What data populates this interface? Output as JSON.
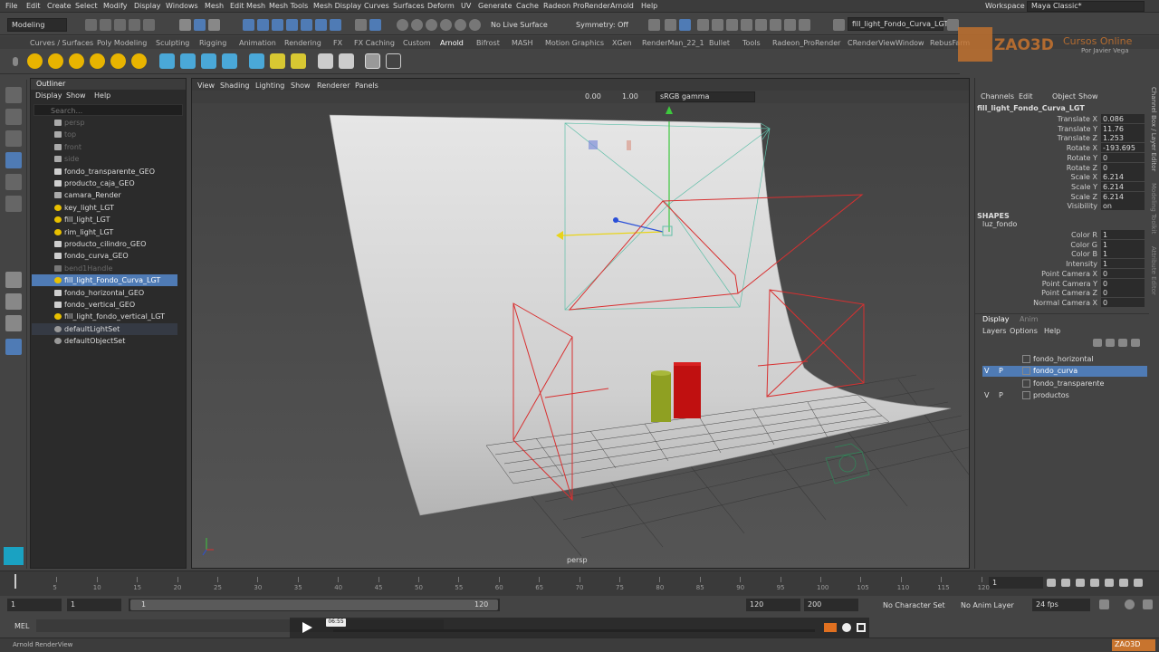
{
  "menubar": {
    "items": [
      "File",
      "Edit",
      "Create",
      "Select",
      "Modify",
      "Display",
      "Windows",
      "Mesh",
      "Edit Mesh",
      "Mesh Tools",
      "Mesh Display",
      "Curves",
      "Surfaces",
      "Deform",
      "UV",
      "Generate",
      "Cache",
      "Radeon ProRender",
      "Arnold",
      "Help"
    ],
    "workspace_label": "Workspace :",
    "workspace_value": "Maya Classic*"
  },
  "status_line": {
    "mode": "Modeling",
    "live_surface": "No Live Surface",
    "symmetry": "Symmetry: Off",
    "active_object": "fill_light_Fondo_Curva_LGT"
  },
  "shelf_tabs": [
    "Curves / Surfaces",
    "Poly Modeling",
    "Sculpting",
    "Rigging",
    "Animation",
    "Rendering",
    "FX",
    "FX Caching",
    "Custom",
    "Arnold",
    "Bifrost",
    "MASH",
    "Motion Graphics",
    "XGen",
    "RenderMan_22_1",
    "Bullet",
    "Tools",
    "Radeon_ProRender",
    "CRenderViewWindow",
    "RebusFarm"
  ],
  "shelf_active": "Arnold",
  "watermark": {
    "brand": "ZAO3D",
    "title": "Cursos Online",
    "subtitle": "Por Javier Vega"
  },
  "outliner": {
    "title": "Outliner",
    "menu": [
      "Display",
      "Show",
      "Help"
    ],
    "search_placeholder": "Search...",
    "items": [
      {
        "label": "persp",
        "kind": "camera",
        "state": "dim"
      },
      {
        "label": "top",
        "kind": "camera",
        "state": "dim"
      },
      {
        "label": "front",
        "kind": "camera",
        "state": "dim"
      },
      {
        "label": "side",
        "kind": "camera",
        "state": "dim"
      },
      {
        "label": "fondo_transparente_GEO",
        "kind": "mesh",
        "state": "normal"
      },
      {
        "label": "producto_caja_GEO",
        "kind": "mesh",
        "state": "normal"
      },
      {
        "label": "camara_Render",
        "kind": "camera",
        "state": "normal"
      },
      {
        "label": "key_light_LGT",
        "kind": "light",
        "state": "normal"
      },
      {
        "label": "fill_light_LGT",
        "kind": "light",
        "state": "normal"
      },
      {
        "label": "rim_light_LGT",
        "kind": "light",
        "state": "normal"
      },
      {
        "label": "producto_cilindro_GEO",
        "kind": "mesh",
        "state": "normal"
      },
      {
        "label": "fondo_curva_GEO",
        "kind": "mesh",
        "state": "normal"
      },
      {
        "label": "bend1Handle",
        "kind": "deformer",
        "state": "dim"
      },
      {
        "label": "fill_light_Fondo_Curva_LGT",
        "kind": "light",
        "state": "selected"
      },
      {
        "label": "fondo_horizontal_GEO",
        "kind": "mesh",
        "state": "normal"
      },
      {
        "label": "fondo_vertical_GEO",
        "kind": "mesh",
        "state": "normal"
      },
      {
        "label": "fill_light_fondo_vertical_LGT",
        "kind": "light",
        "state": "normal"
      },
      {
        "label": "defaultLightSet",
        "kind": "set",
        "state": "highlight"
      },
      {
        "label": "defaultObjectSet",
        "kind": "set",
        "state": "normal"
      }
    ]
  },
  "viewport": {
    "menu": [
      "View",
      "Shading",
      "Lighting",
      "Show",
      "Renderer",
      "Panels"
    ],
    "exposure": "0.00",
    "gamma": "1.00",
    "color_space": "sRGB gamma",
    "camera_label": "persp"
  },
  "channel_box": {
    "tabs": [
      "Channels",
      "Edit",
      "Object",
      "Show"
    ],
    "object_name": "fill_light_Fondo_Curva_LGT",
    "channels": [
      {
        "label": "Translate X",
        "value": "0.086"
      },
      {
        "label": "Translate Y",
        "value": "11.76"
      },
      {
        "label": "Translate Z",
        "value": "1.253"
      },
      {
        "label": "Rotate X",
        "value": "-193.695"
      },
      {
        "label": "Rotate Y",
        "value": "0"
      },
      {
        "label": "Rotate Z",
        "value": "0"
      },
      {
        "label": "Scale X",
        "value": "6.214"
      },
      {
        "label": "Scale Y",
        "value": "6.214"
      },
      {
        "label": "Scale Z",
        "value": "6.214"
      },
      {
        "label": "Visibility",
        "value": "on"
      }
    ],
    "shapes_header": "SHAPES",
    "shape_name": "luz_fondo",
    "shape_channels": [
      {
        "label": "Color R",
        "value": "1"
      },
      {
        "label": "Color G",
        "value": "1"
      },
      {
        "label": "Color B",
        "value": "1"
      },
      {
        "label": "Intensity",
        "value": "1"
      },
      {
        "label": "Point Camera X",
        "value": "0"
      },
      {
        "label": "Point Camera Y",
        "value": "0"
      },
      {
        "label": "Point Camera Z",
        "value": "0"
      },
      {
        "label": "Normal Camera X",
        "value": "0"
      }
    ]
  },
  "layer_editor": {
    "tabs": [
      "Display",
      "Anim"
    ],
    "menu": [
      "Layers",
      "Options",
      "Help"
    ],
    "layers": [
      {
        "name": "fondo_horizontal",
        "v": "",
        "p": "",
        "selected": false
      },
      {
        "name": "fondo_curva",
        "v": "V",
        "p": "P",
        "selected": true
      },
      {
        "name": "fondo_transparente",
        "v": "",
        "p": "",
        "selected": false
      },
      {
        "name": "productos",
        "v": "V",
        "p": "P",
        "selected": false
      }
    ]
  },
  "side_tabs": [
    "Channel Box / Layer Editor",
    "Modeling Toolkit",
    "Attribute Editor"
  ],
  "timeline": {
    "ticks": [
      "5",
      "10",
      "15",
      "20",
      "25",
      "30",
      "35",
      "40",
      "45",
      "50",
      "55",
      "60",
      "65",
      "70",
      "75",
      "80",
      "85",
      "90",
      "95",
      "100",
      "105",
      "110",
      "115",
      "120"
    ],
    "current_frame": "1",
    "range_start": "1",
    "range_inner_start": "1",
    "range_slider_start": "1",
    "range_slider_end": "120",
    "range_inner_end": "120",
    "range_end": "200",
    "character_set": "No Character Set",
    "anim_layer": "No Anim Layer",
    "fps": "24 fps"
  },
  "command_line": {
    "label": "MEL"
  },
  "video_player": {
    "timestamp": "06:55"
  },
  "help_line": "Arnold RenderView",
  "colors": {
    "selection": "#4f7bb5",
    "light_wire": "#d83030",
    "cylinder_green": "#8fa022",
    "cylinder_red": "#c01010"
  }
}
